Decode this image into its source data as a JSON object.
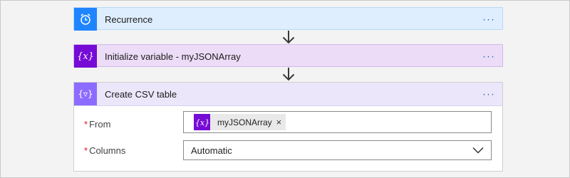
{
  "steps": {
    "recurrence": {
      "title": "Recurrence",
      "more": "···",
      "icon": "alarm-clock-icon",
      "color": "#1f85ff"
    },
    "init_variable": {
      "title": "Initialize variable - myJSONArray",
      "more": "···",
      "icon": "variable-icon",
      "color": "#770bd6"
    },
    "csv_table": {
      "title": "Create CSV table",
      "more": "···",
      "icon": "data-operations-icon",
      "color": "#8c6cff",
      "fields": {
        "from": {
          "required_mark": "*",
          "label": "From",
          "token_text": "myJSONArray",
          "token_remove": "×"
        },
        "columns": {
          "required_mark": "*",
          "label": "Columns",
          "value": "Automatic"
        }
      }
    }
  }
}
